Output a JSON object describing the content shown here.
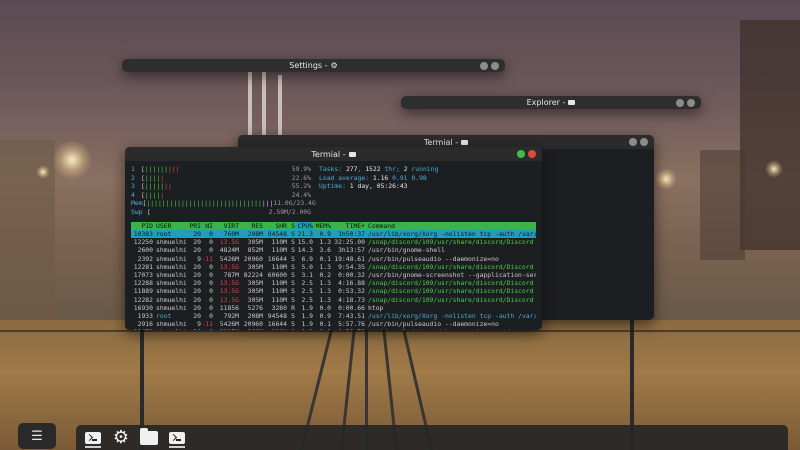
{
  "windows": {
    "settings": {
      "title": "Settings -",
      "icon": "gear-icon"
    },
    "explorer": {
      "title": "Explorer -",
      "icon": "folder-icon"
    },
    "terminal_back": {
      "title": "Termial -",
      "icon": "terminal-icon"
    },
    "terminal_front": {
      "title": "Termial -",
      "icon": "terminal-icon"
    }
  },
  "htop": {
    "cpu_meters": [
      {
        "label": "1",
        "value": "59.9%"
      },
      {
        "label": "2",
        "value": "22.6%"
      },
      {
        "label": "3",
        "value": "55.2%"
      },
      {
        "label": "4",
        "value": "24.4%"
      }
    ],
    "mem": {
      "label": "Mem",
      "value": "11.0G/23.4G"
    },
    "swp": {
      "label": "Swp",
      "value": "2.59M/2.00G"
    },
    "tasks_label": "Tasks:",
    "tasks": "277",
    "threads": "1522",
    "threads_label": "thr;",
    "running": "2",
    "running_label": "running",
    "load_label": "Load average:",
    "load": [
      "1.16",
      "0.91",
      "0.98"
    ],
    "uptime_label": "Uptime:",
    "uptime": "1 day, 05:26:43",
    "columns": [
      "PID",
      "USER",
      "PRI",
      "NI",
      "VIRT",
      "RES",
      "SHR",
      "S",
      "CPU%",
      "MEM%",
      "TIME+",
      "Command"
    ],
    "processes": [
      {
        "pid": "10383",
        "user": "root",
        "pri": "20",
        "ni": "0",
        "virt": "760M",
        "res": "208M",
        "shr": "94548",
        "s": "S",
        "cpu": "21.3",
        "mem": "0.9",
        "time": "1h50:37",
        "cmd": "/usr/lib/xorg/Xorg -nolisten tcp -auth /var/run"
      },
      {
        "pid": "12250",
        "user": "shmuelhiz",
        "pri": "20",
        "ni": "0",
        "virt": "13.5G",
        "res": "305M",
        "shr": "110M",
        "s": "S",
        "cpu": "15.0",
        "mem": "1.3",
        "time": "32:25.00",
        "cmd": "/snap/discord/109/usr/share/discord/Discord --t"
      },
      {
        "pid": "2600",
        "user": "shmuelhiz",
        "pri": "20",
        "ni": "0",
        "virt": "4824M",
        "res": "852M",
        "shr": "110M",
        "s": "S",
        "cpu": "14.3",
        "mem": "3.6",
        "time": "3h13:57",
        "cmd": "/usr/bin/gnome-shell"
      },
      {
        "pid": "2392",
        "user": "shmuelhiz",
        "pri": "9",
        "ni": "-11",
        "virt": "5426M",
        "res": "20960",
        "shr": "16644",
        "s": "S",
        "cpu": "6.9",
        "mem": "0.1",
        "time": "19:48.61",
        "cmd": "/usr/bin/pulseaudio --daemonize=no"
      },
      {
        "pid": "12281",
        "user": "shmuelhiz",
        "pri": "20",
        "ni": "0",
        "virt": "13.5G",
        "res": "305M",
        "shr": "110M",
        "s": "S",
        "cpu": "5.0",
        "mem": "1.3",
        "time": "9:54.35",
        "cmd": "/snap/discord/109/usr/share/discord/Discord --t"
      },
      {
        "pid": "17073",
        "user": "shmuelhiz",
        "pri": "20",
        "ni": "0",
        "virt": "787M",
        "res": "82224",
        "shr": "60600",
        "s": "S",
        "cpu": "3.1",
        "mem": "0.2",
        "time": "0:00.32",
        "cmd": "/usr/bin/gnome-screenshot --gapplication-servic"
      },
      {
        "pid": "12288",
        "user": "shmuelhiz",
        "pri": "20",
        "ni": "0",
        "virt": "13.5G",
        "res": "305M",
        "shr": "110M",
        "s": "S",
        "cpu": "2.5",
        "mem": "1.3",
        "time": "4:16.88",
        "cmd": "/snap/discord/109/usr/share/discord/Discord --t"
      },
      {
        "pid": "11889",
        "user": "shmuelhiz",
        "pri": "20",
        "ni": "0",
        "virt": "13.5G",
        "res": "305M",
        "shr": "110M",
        "s": "S",
        "cpu": "2.5",
        "mem": "1.3",
        "time": "0:53.32",
        "cmd": "/snap/discord/109/usr/share/discord/Discord --t"
      },
      {
        "pid": "12282",
        "user": "shmuelhiz",
        "pri": "20",
        "ni": "0",
        "virt": "13.5G",
        "res": "305M",
        "shr": "110M",
        "s": "S",
        "cpu": "2.5",
        "mem": "1.3",
        "time": "4:18.73",
        "cmd": "/snap/discord/109/usr/share/discord/Discord --t"
      },
      {
        "pid": "16930",
        "user": "shmuelhiz",
        "pri": "20",
        "ni": "0",
        "virt": "11856",
        "res": "5276",
        "shr": "3280",
        "s": "R",
        "cpu": "1.9",
        "mem": "0.0",
        "time": "0:00.66",
        "cmd": "htop"
      },
      {
        "pid": "1933",
        "user": "root",
        "pri": "20",
        "ni": "0",
        "virt": "792M",
        "res": "208M",
        "shr": "94548",
        "s": "S",
        "cpu": "1.9",
        "mem": "0.9",
        "time": "7:43.51",
        "cmd": "/usr/lib/xorg/Xorg -nolisten tcp -auth /var/run"
      },
      {
        "pid": "2916",
        "user": "shmuelhiz",
        "pri": "9",
        "ni": "-11",
        "virt": "5426M",
        "res": "20960",
        "shr": "16644",
        "s": "S",
        "cpu": "1.9",
        "mem": "0.1",
        "time": "5:57.76",
        "cmd": "/usr/bin/pulseaudio --daemonize=no"
      },
      {
        "pid": "11471",
        "user": "shmuelhiz",
        "pri": "20",
        "ni": "0",
        "virt": "8815M",
        "res": "268M",
        "shr": "110M",
        "s": "S",
        "cpu": "1.2",
        "mem": "1.1",
        "time": "0:50.79",
        "cmd": "/opt/google/chrome/chrome --type=renderer --dis"
      },
      {
        "pid": "9170",
        "user": "shmuelhiz",
        "pri": "20",
        "ni": "0",
        "virt": "4558M",
        "res": "158M",
        "shr": "91356",
        "s": "S",
        "cpu": "1.2",
        "mem": "0.7",
        "time": "0:05.88",
        "cmd": "/opt/google/chrome/chrome --type=renderer --dis"
      }
    ]
  },
  "dock": {
    "menu_icon": "menu-icon",
    "items": [
      "terminal-icon",
      "gear-icon",
      "folder-icon",
      "terminal-icon"
    ]
  },
  "colors": {
    "selected_row": "#1fa0b8",
    "header_bar": "#3bb34a",
    "close_button": "#e24a3b",
    "max_button": "#3bbf4a"
  }
}
